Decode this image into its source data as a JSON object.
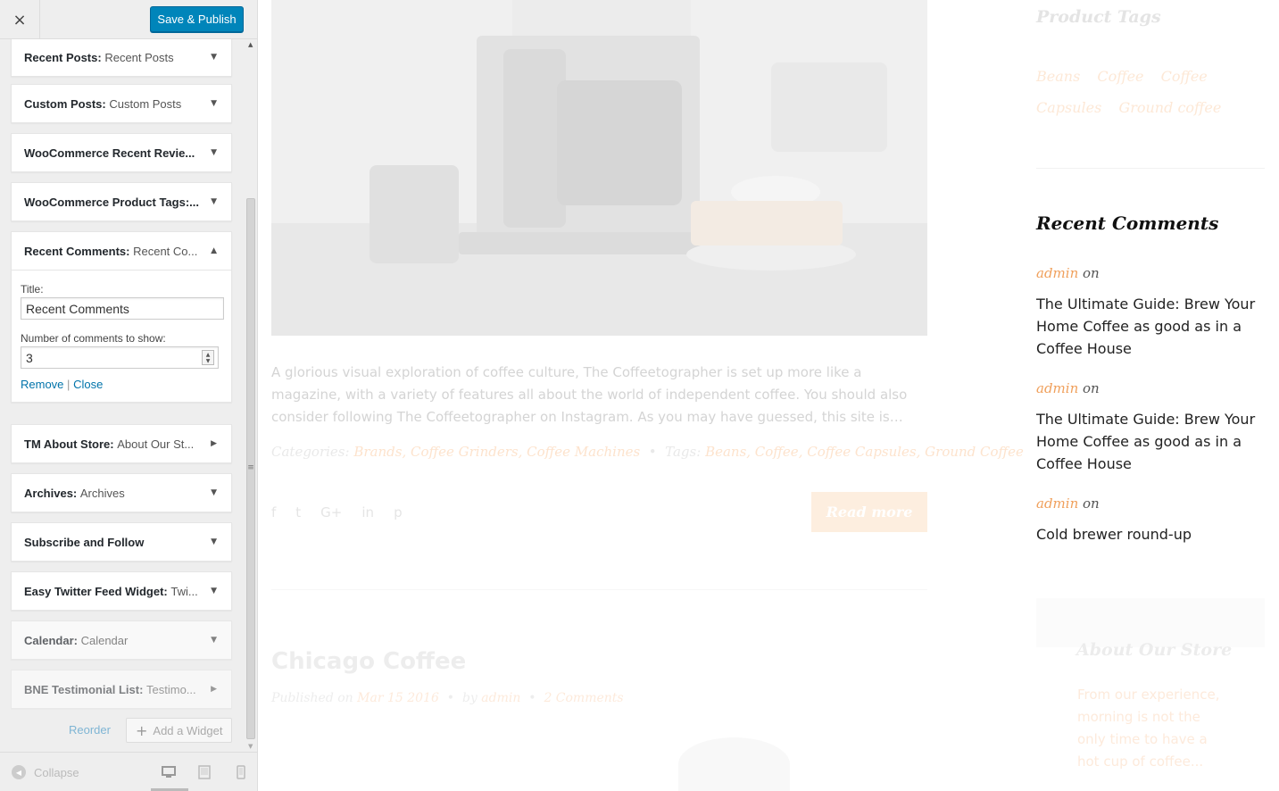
{
  "customizer": {
    "close_icon": "×",
    "publish_label": "Save & Publish",
    "widgets": [
      {
        "name": "Recent Posts",
        "title": "Recent Posts",
        "state": "collapsed"
      },
      {
        "name": "Custom Posts",
        "title": "Custom Posts",
        "state": "collapsed"
      },
      {
        "name": "WooCommerce Recent Revie...",
        "title": "",
        "state": "collapsed"
      },
      {
        "name": "WooCommerce Product Tags:...",
        "title": "",
        "state": "collapsed"
      },
      {
        "name": "Recent Comments",
        "title": "Recent Co...",
        "state": "expanded"
      },
      {
        "name": "TM About Store",
        "title": "About Our St...",
        "state": "collapsed"
      },
      {
        "name": "Archives",
        "title": "Archives",
        "state": "collapsed"
      },
      {
        "name": "Subscribe and Follow",
        "title": "",
        "state": "collapsed"
      },
      {
        "name": "Easy Twitter Feed Widget",
        "title": "Twi...",
        "state": "collapsed"
      },
      {
        "name": "Calendar",
        "title": "Calendar",
        "state": "collapsed"
      },
      {
        "name": "BNE Testimonial List",
        "title": "Testimo...",
        "state": "collapsed"
      }
    ],
    "expanded_form": {
      "title_label": "Title:",
      "title_value": "Recent Comments",
      "number_label": "Number of comments to show:",
      "number_value": "3",
      "remove_label": "Remove",
      "separator": "|",
      "close_label": "Close"
    },
    "reorder_label": "Reorder",
    "add_widget_label": "Add a Widget",
    "collapse_label": "Collapse",
    "devices": [
      "desktop-icon",
      "tablet-icon",
      "mobile-icon"
    ],
    "accent_color": "#0085ba"
  },
  "preview": {
    "excerpt": "A glorious visual exploration of coffee culture, The Coffeetographer is set up more like a magazine, with a variety of features all about the world of independent coffee. You should also consider following The Coffeetographer on Instagram. As you may have guessed, this site is…",
    "categories_label": "Categories:",
    "categories_value": "Brands, Coffee Grinders, Coffee Machines",
    "meta_bullet": "•",
    "tags_label": "Tags:",
    "tags_value": "Beans, Coffee, Coffee Capsules, Ground Coffee",
    "social_icons": [
      "facebook-icon",
      "twitter-icon",
      "google-plus-icon",
      "linkedin-icon",
      "pinterest-icon"
    ],
    "social_glyphs": [
      "f",
      "t",
      "G+",
      "in",
      "p"
    ],
    "read_more_label": "Read more",
    "post2_title": "Chicago Coffee",
    "post2_published_label": "Published on",
    "post2_date": "Mar 15 2016",
    "post2_by_label": "by",
    "post2_author": "admin",
    "post2_comments": "2 Comments",
    "product_tags_title": "Product Tags",
    "product_tags": [
      "Beans",
      "Coffee",
      "Coffee Capsules",
      "Ground coffee"
    ],
    "recent_comments_title": "Recent Comments",
    "recent_comments": [
      {
        "author": "admin",
        "on": "on",
        "post": "The Ultimate Guide: Brew Your Home Coffee as good as in a Coffee House"
      },
      {
        "author": "admin",
        "on": "on",
        "post": "The Ultimate Guide: Brew Your Home Coffee as good as in a Coffee House"
      },
      {
        "author": "admin",
        "on": "on",
        "post": "Cold brewer round-up"
      }
    ],
    "about_title": "About Our Store",
    "about_text": "From our experience, morning is not the only time to have a hot cup of coffee...",
    "link_color": "#f0a05c"
  }
}
